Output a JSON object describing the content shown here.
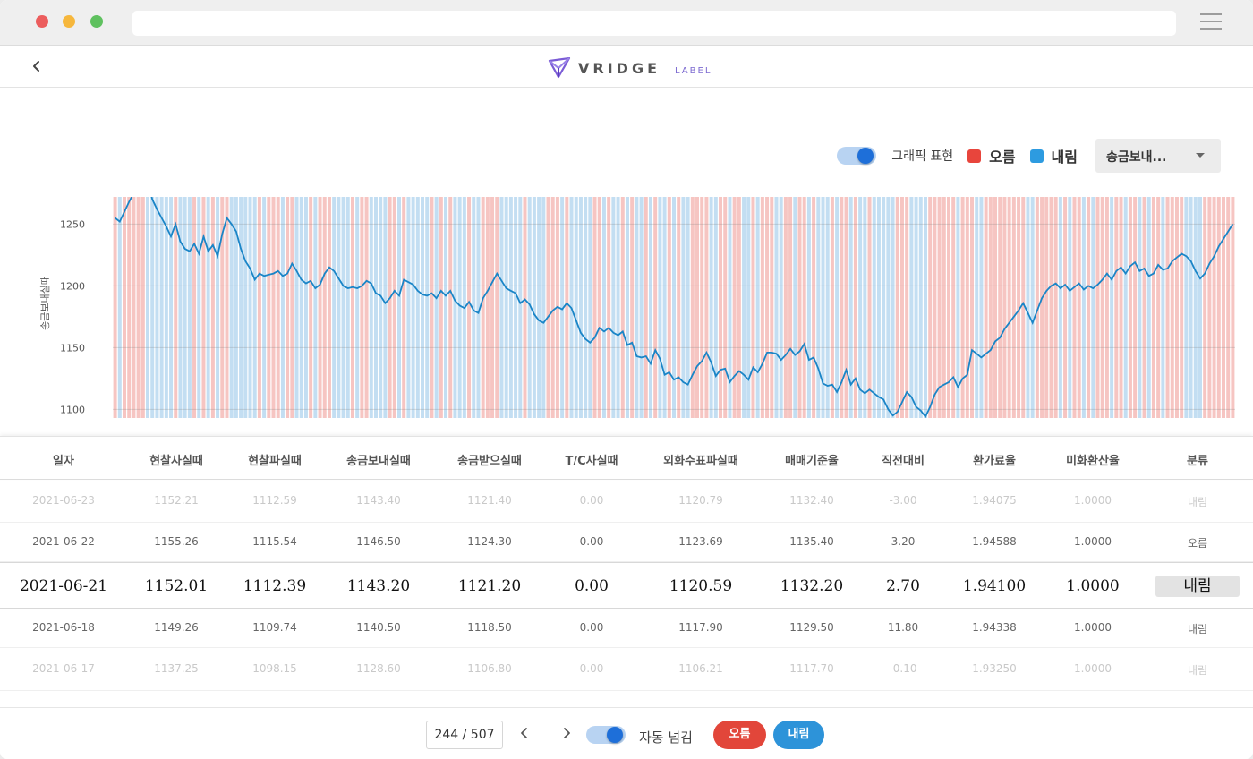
{
  "header": {
    "logo_text": "VRIDGE",
    "logo_sub": "LABEL"
  },
  "controls": {
    "graphic_label": "그래픽 표현",
    "legend_up": "오름",
    "legend_down": "내림",
    "select_value": "송금보내...",
    "colors": {
      "up": "#e8453c",
      "down": "#2d9be0",
      "toggle_on": "#1e6fd9"
    }
  },
  "chart_data": {
    "type": "line",
    "ylabel": "송금보내실때",
    "yticks": [
      1250,
      1200,
      1150,
      1100
    ],
    "ylim": [
      1093,
      1272
    ],
    "grid": true,
    "background_bands": "per-point category shading (오름 = red, 내림 = blue)",
    "series": [
      {
        "values": [
          1255,
          1252,
          1260,
          1268,
          1275,
          1282,
          1290,
          1285,
          1270,
          1262,
          1255,
          1248,
          1240,
          1250,
          1236,
          1230,
          1228,
          1234,
          1226,
          1240,
          1228,
          1233,
          1224,
          1242,
          1255,
          1250,
          1244,
          1230,
          1220,
          1214,
          1205,
          1210,
          1208,
          1209,
          1210,
          1212,
          1208,
          1210,
          1218,
          1212,
          1205,
          1202,
          1204,
          1198,
          1201,
          1210,
          1215,
          1212,
          1206,
          1200,
          1198,
          1199,
          1198,
          1200,
          1204,
          1202,
          1194,
          1192,
          1186,
          1190,
          1196,
          1192,
          1205,
          1203,
          1201,
          1196,
          1193,
          1192,
          1194,
          1190,
          1196,
          1192,
          1196,
          1188,
          1184,
          1182,
          1187,
          1180,
          1178,
          1190,
          1196,
          1203,
          1210,
          1204,
          1198,
          1196,
          1194,
          1186,
          1189,
          1185,
          1177,
          1172,
          1170,
          1175,
          1180,
          1183,
          1181,
          1186,
          1182,
          1172,
          1162,
          1157,
          1154,
          1158,
          1166,
          1163,
          1166,
          1162,
          1160,
          1163,
          1152,
          1154,
          1143,
          1142,
          1143,
          1137,
          1148,
          1141,
          1128,
          1130,
          1124,
          1126,
          1122,
          1120,
          1128,
          1135,
          1139,
          1146,
          1138,
          1127,
          1132,
          1133,
          1122,
          1127,
          1131,
          1128,
          1124,
          1134,
          1130,
          1137,
          1146,
          1146,
          1145,
          1140,
          1144,
          1149,
          1144,
          1147,
          1153,
          1140,
          1142,
          1133,
          1121,
          1119,
          1120,
          1114,
          1122,
          1132,
          1120,
          1125,
          1116,
          1113,
          1116,
          1113,
          1110,
          1108,
          1100,
          1095,
          1098,
          1106,
          1114,
          1110,
          1102,
          1099,
          1094,
          1102,
          1112,
          1118,
          1120,
          1122,
          1126,
          1118,
          1125,
          1128,
          1148,
          1145,
          1142,
          1145,
          1148,
          1155,
          1158,
          1165,
          1170,
          1175,
          1180,
          1186,
          1178,
          1170,
          1180,
          1190,
          1196,
          1200,
          1202,
          1198,
          1201,
          1196,
          1199,
          1202,
          1197,
          1200,
          1198,
          1201,
          1205,
          1210,
          1205,
          1212,
          1215,
          1210,
          1216,
          1219,
          1212,
          1214,
          1208,
          1210,
          1217,
          1213,
          1214,
          1220,
          1223,
          1226,
          1224,
          1220,
          1212,
          1206,
          1210,
          1218,
          1224,
          1232,
          1238,
          1244,
          1250
        ]
      }
    ]
  },
  "table": {
    "headers": [
      "일자",
      "현찰사실때",
      "현찰파실때",
      "송금보내실때",
      "송금받으실때",
      "T/C사실때",
      "외화수표파실때",
      "매매기준율",
      "직전대비",
      "환가료율",
      "미화환산율",
      "분류"
    ],
    "rows": [
      [
        "2021-06-23",
        "1152.21",
        "1112.59",
        "1143.40",
        "1121.40",
        "0.00",
        "1120.79",
        "1132.40",
        "-3.00",
        "1.94075",
        "1.0000",
        "내림"
      ],
      [
        "2021-06-22",
        "1155.26",
        "1115.54",
        "1146.50",
        "1124.30",
        "0.00",
        "1123.69",
        "1135.40",
        "3.20",
        "1.94588",
        "1.0000",
        "오름"
      ],
      [
        "2021-06-21",
        "1152.01",
        "1112.39",
        "1143.20",
        "1121.20",
        "0.00",
        "1120.59",
        "1132.20",
        "2.70",
        "1.94100",
        "1.0000",
        "내림"
      ],
      [
        "2021-06-18",
        "1149.26",
        "1109.74",
        "1140.50",
        "1118.50",
        "0.00",
        "1117.90",
        "1129.50",
        "11.80",
        "1.94338",
        "1.0000",
        "내림"
      ],
      [
        "2021-06-17",
        "1137.25",
        "1098.15",
        "1128.60",
        "1106.80",
        "0.00",
        "1106.21",
        "1117.70",
        "-0.10",
        "1.93250",
        "1.0000",
        "내림"
      ]
    ]
  },
  "footer": {
    "page": "244 / 507",
    "auto_label": "자동 넘김",
    "up_button": "오름",
    "down_button": "내림"
  }
}
